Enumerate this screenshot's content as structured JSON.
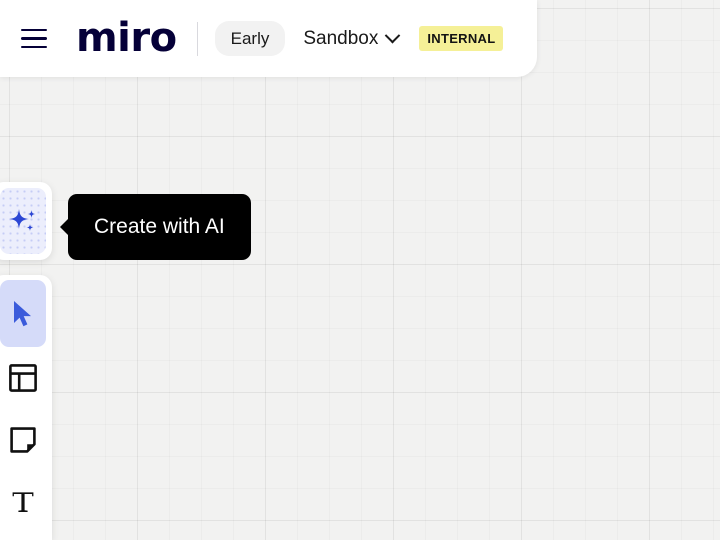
{
  "header": {
    "menu_icon": "hamburger-menu-icon",
    "logo_text": "miro",
    "early_badge": "Early",
    "project_name": "Sandbox",
    "project_chevron_icon": "chevron-down-icon",
    "internal_badge": "INTERNAL",
    "colors": {
      "internal_badge_bg": "#f5f097",
      "early_badge_bg": "#f2f2f2",
      "panel_bg": "#ffffff",
      "text": "#050038"
    }
  },
  "toolbar": {
    "ai_tool": {
      "name": "Create with AI",
      "icon": "ai-sparkle-icon",
      "active": false,
      "bg": "#eceefc"
    },
    "tools": [
      {
        "name": "Select",
        "icon": "cursor-arrow-icon",
        "active": true
      },
      {
        "name": "Templates",
        "icon": "template-layout-icon",
        "active": false
      },
      {
        "name": "Sticky note",
        "icon": "sticky-note-icon",
        "active": false
      },
      {
        "name": "Text",
        "icon": "text-tool-icon",
        "active": false
      }
    ]
  },
  "tooltip": {
    "text": "Create with AI",
    "bg": "#000000",
    "color": "#ffffff"
  },
  "canvas": {
    "background": "#f2f2f1",
    "grid": "on"
  }
}
